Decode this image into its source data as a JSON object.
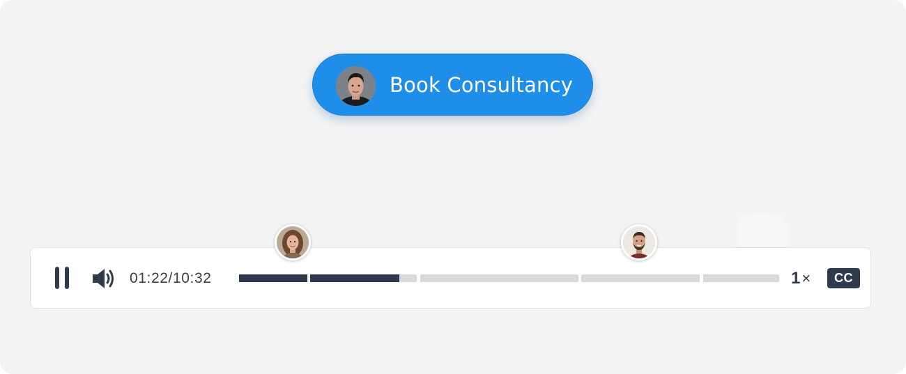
{
  "cta": {
    "label": "Book Consultancy",
    "color": "#1e8ee8",
    "avatar_icon": "consultant-avatar"
  },
  "player": {
    "state": "playing",
    "pause_icon": "pause-icon",
    "volume_icon": "volume-icon",
    "time_display": "01:22/10:32",
    "current_time": "01:22",
    "duration": "10:32",
    "progress": {
      "played_fraction": 0.297,
      "chapters": [
        {
          "start_fraction": 0.0,
          "end_fraction": 0.126,
          "played": true
        },
        {
          "start_fraction": 0.132,
          "end_fraction": 0.329,
          "played": "partial"
        },
        {
          "start_fraction": 0.335,
          "end_fraction": 0.628,
          "played": false
        },
        {
          "start_fraction": 0.634,
          "end_fraction": 0.853,
          "played": false
        },
        {
          "start_fraction": 0.859,
          "end_fraction": 1.0,
          "played": false
        }
      ],
      "played_color": "#2f3a4f",
      "unplayed_color": "#d9d9db"
    },
    "speed": {
      "value": "1",
      "suffix": "×"
    },
    "captions_label": "CC",
    "markers": [
      {
        "icon": "woman-avatar",
        "at_fraction": 0.099
      },
      {
        "icon": "man-avatar",
        "at_fraction": 0.741
      }
    ]
  },
  "colors": {
    "background": "#f3f3f4",
    "player_background": "#ffffff",
    "dark": "#2f3a4f"
  }
}
